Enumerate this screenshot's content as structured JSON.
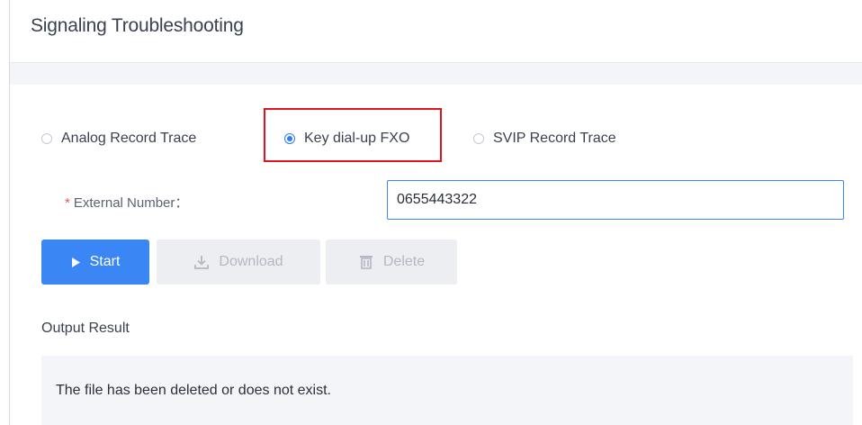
{
  "page": {
    "title": "Signaling Troubleshooting"
  },
  "trace_options": [
    {
      "label": "Analog Record Trace",
      "selected": false
    },
    {
      "label": "Key dial-up FXO",
      "selected": true
    },
    {
      "label": "SVIP Record Trace",
      "selected": false
    }
  ],
  "form": {
    "required_marker": "*",
    "external_number_label": "External Number：",
    "external_number_value": "0655443322"
  },
  "buttons": {
    "start": {
      "label": "Start",
      "icon": "play-icon",
      "enabled": true
    },
    "download": {
      "label": "Download",
      "icon": "download-icon",
      "enabled": false
    },
    "delete": {
      "label": "Delete",
      "icon": "trash-icon",
      "enabled": false
    }
  },
  "output": {
    "label": "Output Result",
    "message": "The file has been deleted or does not exist."
  },
  "colors": {
    "accent": "#3a86f4",
    "highlight": "#e0141b",
    "required": "#f05454",
    "disabled_bg": "#eceef2",
    "panel_bg": "#f3f5f8"
  }
}
